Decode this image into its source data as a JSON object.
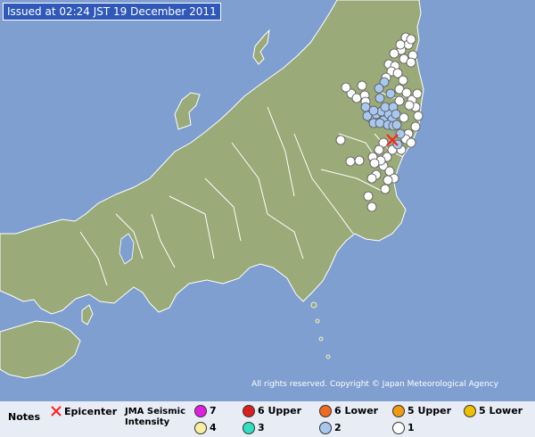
{
  "issued": "Issued at 02:24 JST  19 December 2011",
  "copyright": "All rights reserved. Copyright © Japan Meteorological Agency",
  "legend": {
    "notes": "Notes",
    "epicenter_label": "Epicenter",
    "intensity_title": [
      "JMA Seismic",
      "Intensity"
    ],
    "items": [
      {
        "label": "7",
        "color": "#e020e0"
      },
      {
        "label": "6 Upper",
        "color": "#d82020"
      },
      {
        "label": "6 Lower",
        "color": "#f06a20"
      },
      {
        "label": "5 Upper",
        "color": "#f09a10"
      },
      {
        "label": "5 Lower",
        "color": "#f0c000"
      },
      {
        "label": "4",
        "color": "#f8f0a0"
      },
      {
        "label": "3",
        "color": "#30e0c0"
      },
      {
        "label": "2",
        "color": "#a8c8f0"
      },
      {
        "label": "1",
        "color": "#ffffff"
      }
    ]
  },
  "colors": {
    "sea": "#7f9fd0",
    "land": "#9aaa78",
    "border": "#ffffff",
    "epicenter": "#ff2020"
  },
  "stations": {
    "intensity2": [
      [
        410,
        120
      ],
      [
        416,
        132
      ],
      [
        422,
        128
      ],
      [
        428,
        125
      ],
      [
        430,
        135
      ],
      [
        436,
        128
      ],
      [
        440,
        134
      ],
      [
        419,
        138
      ],
      [
        426,
        138
      ],
      [
        435,
        140
      ],
      [
        441,
        141
      ],
      [
        432,
        120
      ],
      [
        426,
        110
      ],
      [
        438,
        105
      ],
      [
        431,
        92
      ],
      [
        425,
        99
      ],
      [
        441,
        120
      ],
      [
        444,
        128
      ],
      [
        449,
        150
      ],
      [
        446,
        162
      ],
      [
        445,
        140
      ],
      [
        412,
        130
      ],
      [
        419,
        124
      ]
    ],
    "intensity1": [
      [
        455,
        42
      ],
      [
        458,
        50
      ],
      [
        461,
        44
      ],
      [
        450,
        56
      ],
      [
        463,
        62
      ],
      [
        453,
        66
      ],
      [
        461,
        70
      ],
      [
        436,
        72
      ],
      [
        443,
        74
      ],
      [
        439,
        80
      ],
      [
        446,
        82
      ],
      [
        452,
        90
      ],
      [
        448,
        100
      ],
      [
        456,
        104
      ],
      [
        462,
        112
      ],
      [
        466,
        120
      ],
      [
        469,
        130
      ],
      [
        466,
        142
      ],
      [
        458,
        150
      ],
      [
        455,
        156
      ],
      [
        461,
        160
      ],
      [
        450,
        168
      ],
      [
        440,
        168
      ],
      [
        434,
        176
      ],
      [
        430,
        186
      ],
      [
        437,
        192
      ],
      [
        442,
        200
      ],
      [
        435,
        202
      ],
      [
        432,
        212
      ],
      [
        422,
        196
      ],
      [
        417,
        200
      ],
      [
        427,
        180
      ],
      [
        430,
        160
      ],
      [
        425,
        168
      ],
      [
        418,
        176
      ],
      [
        420,
        183
      ],
      [
        403,
        180
      ],
      [
        393,
        181
      ],
      [
        382,
        157
      ],
      [
        394,
        105
      ],
      [
        388,
        98
      ],
      [
        406,
        96
      ],
      [
        409,
        107
      ],
      [
        413,
        220
      ],
      [
        417,
        232
      ],
      [
        449,
        50
      ],
      [
        442,
        60
      ],
      [
        433,
        87
      ],
      [
        410,
        114
      ],
      [
        400,
        110
      ],
      [
        453,
        132
      ],
      [
        459,
        118
      ],
      [
        448,
        113
      ],
      [
        468,
        105
      ]
    ]
  },
  "epicenter": {
    "lon_lat_hint": "northern Ibaraki"
  }
}
